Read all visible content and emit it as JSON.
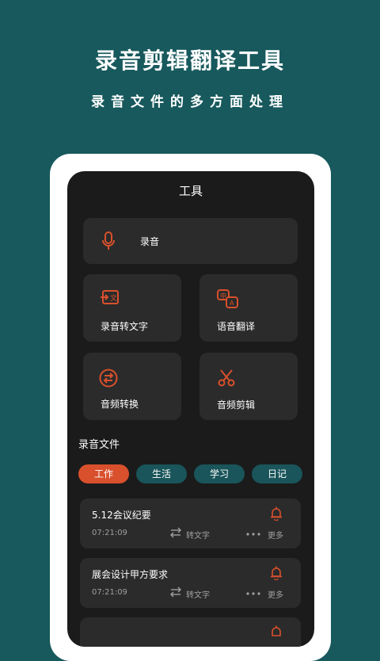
{
  "promo": {
    "title": "录音剪辑翻译工具",
    "subtitle": "录音文件的多方面处理"
  },
  "screen": {
    "title": "工具",
    "tools": {
      "record": {
        "label": "录音",
        "icon": "microphone-icon"
      },
      "speech_to_text": {
        "label": "录音转文字",
        "icon": "text-convert-icon"
      },
      "voice_translate": {
        "label": "语音翻译",
        "icon": "translate-icon"
      },
      "audio_convert": {
        "label": "音频转换",
        "icon": "swap-circle-icon"
      },
      "audio_cut": {
        "label": "音频剪辑",
        "icon": "scissors-icon"
      }
    },
    "files_section_title": "录音文件",
    "tabs": [
      {
        "label": "工作",
        "active": true
      },
      {
        "label": "生活",
        "active": false
      },
      {
        "label": "学习",
        "active": false
      },
      {
        "label": "日记",
        "active": false
      }
    ],
    "files": [
      {
        "name": "5.12会议纪要",
        "time": "07:21:09",
        "convert_label": "转文字",
        "more_label": "更多"
      },
      {
        "name": "展会设计甲方要求",
        "time": "07:21:09",
        "convert_label": "转文字",
        "more_label": "更多"
      }
    ]
  },
  "colors": {
    "background": "#17595d",
    "accent": "#d9502c",
    "card": "#2b2b2b",
    "screen": "#1b1b1b",
    "tab_inactive": "#19555a"
  }
}
